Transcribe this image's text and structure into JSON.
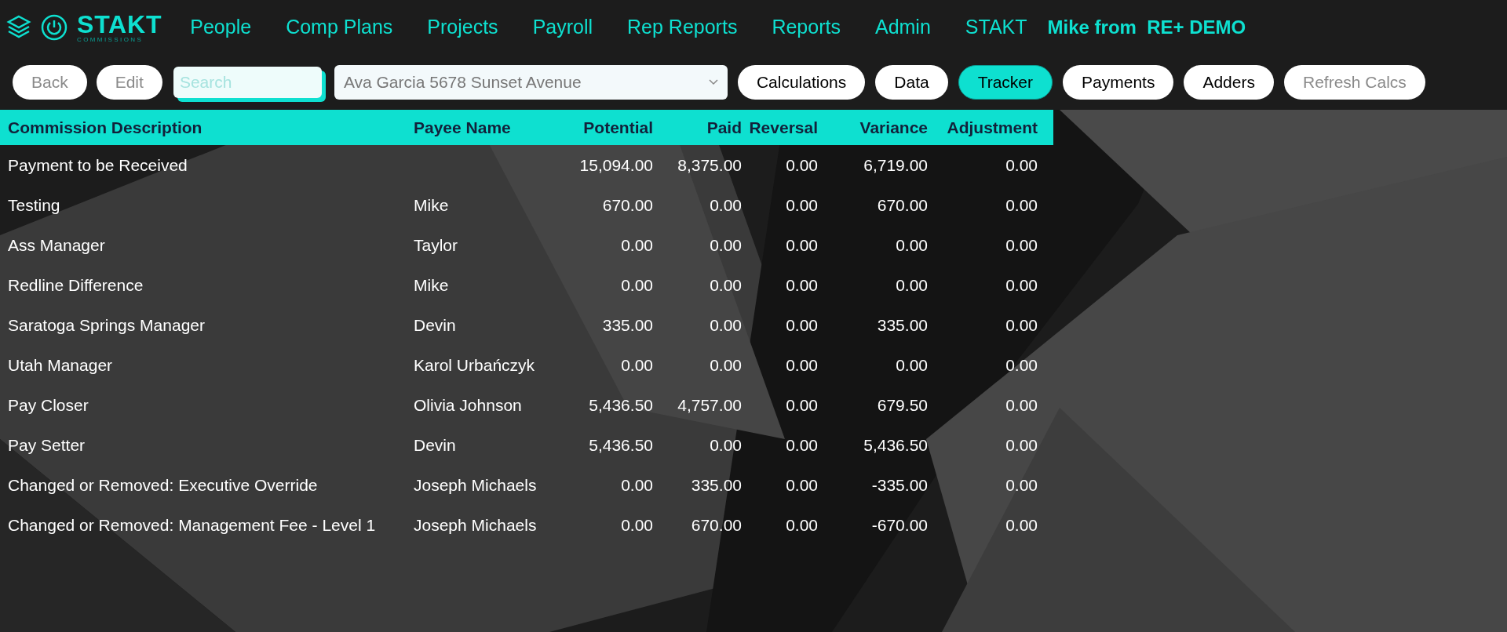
{
  "brand": {
    "name": "STAKT",
    "tagline": "COMMISSIONS"
  },
  "nav": [
    {
      "label": "People"
    },
    {
      "label": "Comp Plans"
    },
    {
      "label": "Projects"
    },
    {
      "label": "Payroll"
    },
    {
      "label": "Rep Reports"
    },
    {
      "label": "Reports"
    },
    {
      "label": "Admin"
    },
    {
      "label": "STAKT"
    }
  ],
  "user": "Mike from  RE+ DEMO",
  "toolbar": {
    "left_buttons": [
      {
        "label": "Back",
        "disabled": true
      },
      {
        "label": "Edit",
        "disabled": true
      }
    ],
    "search": {
      "placeholder": "Search"
    },
    "project_select": {
      "value": "Ava Garcia 5678 Sunset Avenue"
    },
    "tabs": [
      {
        "label": "Calculations",
        "selected": false
      },
      {
        "label": "Data",
        "selected": false
      },
      {
        "label": "Tracker",
        "selected": true
      },
      {
        "label": "Payments",
        "selected": false
      },
      {
        "label": "Adders",
        "selected": false
      }
    ],
    "refresh": {
      "label": "Refresh Calcs",
      "disabled": true
    }
  },
  "table": {
    "columns": [
      "Commission Description",
      "Payee Name",
      "Potential",
      "Paid",
      "Reversal",
      "Variance",
      "Adjustment"
    ],
    "rows": [
      [
        "Payment to be Received",
        "",
        "15,094.00",
        "8,375.00",
        "0.00",
        "6,719.00",
        "0.00"
      ],
      [
        "Testing",
        "Mike",
        "670.00",
        "0.00",
        "0.00",
        "670.00",
        "0.00"
      ],
      [
        "Ass Manager",
        "Taylor",
        "0.00",
        "0.00",
        "0.00",
        "0.00",
        "0.00"
      ],
      [
        "Redline Difference",
        "Mike",
        "0.00",
        "0.00",
        "0.00",
        "0.00",
        "0.00"
      ],
      [
        "Saratoga Springs Manager",
        "Devin",
        "335.00",
        "0.00",
        "0.00",
        "335.00",
        "0.00"
      ],
      [
        "Utah Manager",
        "Karol Urbańczyk",
        "0.00",
        "0.00",
        "0.00",
        "0.00",
        "0.00"
      ],
      [
        "Pay Closer",
        "Olivia Johnson",
        "5,436.50",
        "4,757.00",
        "0.00",
        "679.50",
        "0.00"
      ],
      [
        "Pay Setter",
        "Devin",
        "5,436.50",
        "0.00",
        "0.00",
        "5,436.50",
        "0.00"
      ],
      [
        "Changed or Removed: Executive Override",
        "Joseph Michaels",
        "0.00",
        "335.00",
        "0.00",
        "-335.00",
        "0.00"
      ],
      [
        "Changed or Removed: Management Fee - Level 1",
        "Joseph Michaels",
        "0.00",
        "670.00",
        "0.00",
        "-670.00",
        "0.00"
      ]
    ]
  }
}
